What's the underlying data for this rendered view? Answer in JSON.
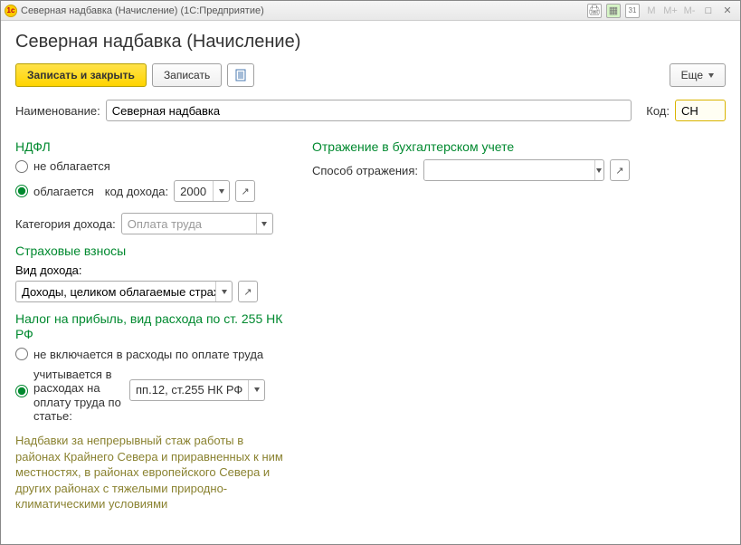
{
  "window": {
    "title": "Северная надбавка (Начисление)  (1С:Предприятие)"
  },
  "page": {
    "title": "Северная надбавка (Начисление)"
  },
  "toolbar": {
    "write_and_close": "Записать и закрыть",
    "write": "Записать",
    "more": "Еще"
  },
  "fields": {
    "name_label": "Наименование:",
    "name_value": "Северная надбавка",
    "code_label": "Код:",
    "code_value": "СН"
  },
  "ndfl": {
    "heading": "НДФЛ",
    "not_taxed": "не облагается",
    "taxed": "облагается",
    "income_code_label": "код дохода:",
    "income_code_value": "2000",
    "category_label": "Категория дохода:",
    "category_value": "Оплата труда"
  },
  "insurance": {
    "heading": "Страховые взносы",
    "income_type_label": "Вид дохода:",
    "income_type_value": "Доходы, целиком облагаемые страховыми взносами"
  },
  "profit_tax": {
    "heading": "Налог на прибыль, вид расхода по ст. 255 НК РФ",
    "not_included": "не включается в расходы по оплате труда",
    "included": "учитывается в расходах на оплату труда по статье:",
    "article_value": "пп.12, ст.255 НК РФ"
  },
  "accounting": {
    "heading": "Отражение в бухгалтерском учете",
    "method_label": "Способ отражения:",
    "method_value": ""
  },
  "footnote": "Надбавки за непрерывный стаж работы в районах Крайнего Севера и приравненных к ним местностях, в районах европейского Севера и других районах с тяжелыми природно-климатическими условиями"
}
